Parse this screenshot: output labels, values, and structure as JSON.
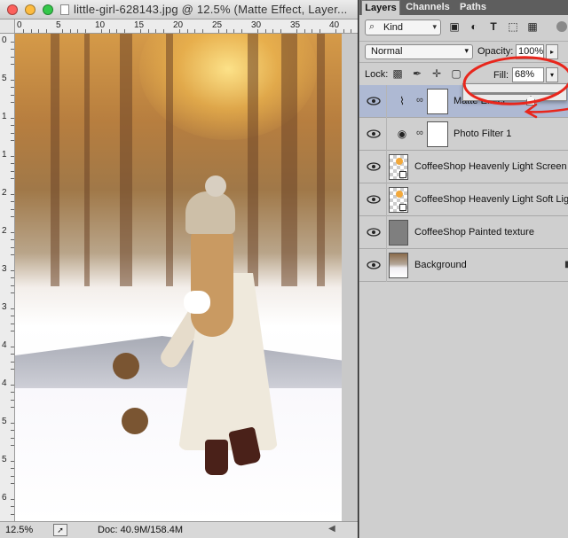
{
  "document": {
    "title": "little-girl-628143.jpg @ 12.5% (Matte Effect, Layer...",
    "zoom": "12.5%",
    "doc_size": "Doc: 40.9M/158.4M",
    "ruler_top": [
      "0",
      "5",
      "10",
      "15",
      "20",
      "25",
      "30",
      "35",
      "40"
    ],
    "ruler_left": [
      "0",
      "5",
      "1",
      "1",
      "2",
      "2",
      "3",
      "3",
      "4",
      "4",
      "5",
      "5",
      "6"
    ]
  },
  "panel": {
    "tabs": [
      "Layers",
      "Channels",
      "Paths"
    ],
    "active_tab": "Layers",
    "filter": {
      "kind_label": "Kind",
      "search_icon": "search-icon"
    },
    "blend_mode": "Normal",
    "opacity_label": "Opacity:",
    "opacity_value": "100%",
    "lock_label": "Lock:",
    "fill_label": "Fill:",
    "fill_value": "68%",
    "fill_slider_value": 0.68,
    "layers": [
      {
        "name": "Matte Effect",
        "type": "adjustment",
        "icon": "curves-icon",
        "selected": true
      },
      {
        "name": "Photo Filter 1",
        "type": "adjustment",
        "icon": "photo-filter-icon",
        "selected": false
      },
      {
        "name": "CoffeeShop Heavenly Light Screen",
        "type": "smart-object",
        "selected": false
      },
      {
        "name": "CoffeeShop Heavenly Light Soft Light",
        "type": "smart-object",
        "selected": false
      },
      {
        "name": "CoffeeShop Painted texture",
        "type": "image",
        "selected": false
      },
      {
        "name": "Background",
        "type": "image",
        "selected": false
      }
    ]
  },
  "colors": {
    "selected_layer": "#aeb9d3",
    "annotation": "#e8261c",
    "panel_bg": "#cfcfcf"
  }
}
